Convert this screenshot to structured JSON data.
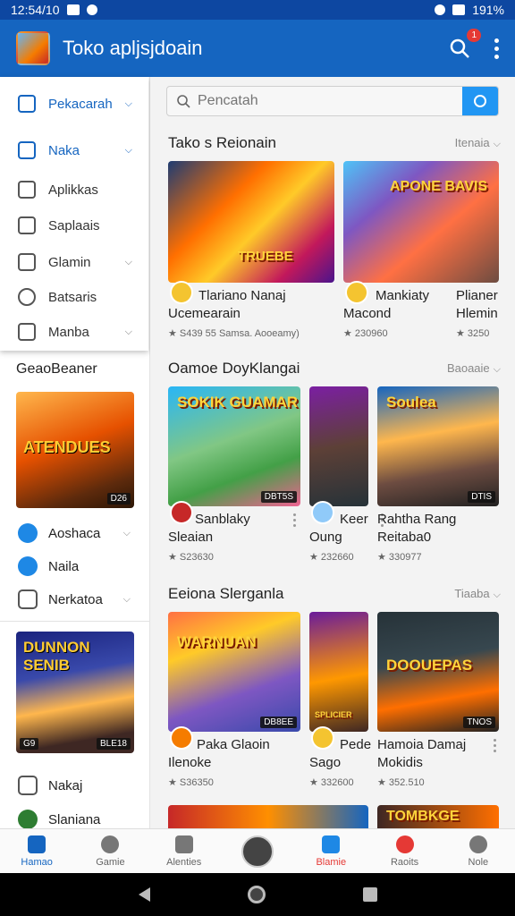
{
  "status_bar": {
    "time": "12:54/10",
    "battery": "191%"
  },
  "app_bar": {
    "title": "Toko apljsjdoain",
    "notification_count": "1"
  },
  "menu": {
    "items": [
      {
        "label": "Pekacarah",
        "icon": "home-icon",
        "active": true,
        "chevron": true
      },
      {
        "label": "Naka",
        "icon": "recycle-icon",
        "active": true,
        "chevron": true
      },
      {
        "label": "Aplikkas",
        "icon": "folder-icon",
        "active": false,
        "chevron": false
      },
      {
        "label": "Saplaais",
        "icon": "app-box-icon",
        "active": false,
        "chevron": false
      },
      {
        "label": "Glamin",
        "icon": "gamepad-icon",
        "active": false,
        "chevron": true
      },
      {
        "label": "Batsaris",
        "icon": "chat-icon",
        "active": false,
        "chevron": false
      },
      {
        "label": "Manba",
        "icon": "tag-icon",
        "active": false,
        "chevron": true
      }
    ]
  },
  "left_panel": {
    "section_title": "GeaoBeaner",
    "featured1": {
      "title": "ATENDUES",
      "tag": "D26"
    },
    "list1": [
      {
        "label": "Aoshaca",
        "icon": "compass-icon",
        "chevron": true
      },
      {
        "label": "Naila",
        "icon": "star-icon",
        "chevron": false
      },
      {
        "label": "Nerkatoa",
        "icon": "shield-icon",
        "chevron": true
      }
    ],
    "featured2": {
      "title": "DUNNON SENIB",
      "tag1": "G9",
      "tag2": "BLE18"
    },
    "list2": [
      {
        "label": "Nakaj",
        "icon": "bag-icon"
      },
      {
        "label": "Slaniana",
        "icon": "leaf-icon"
      }
    ]
  },
  "search": {
    "placeholder": "Pencatah",
    "value": ""
  },
  "sections": [
    {
      "title": "Tako s Reionain",
      "more": "Itenaia",
      "cards": [
        {
          "art_title": "TRUEBE",
          "name1": "Tlariano Nanaj",
          "name2": "Ucemearain",
          "meta": "★ S439 55 Samsa. Aooeamy)",
          "tag": ""
        },
        {
          "art_title": "APONE BAVIS",
          "name1": "Mankiaty",
          "name2": "Macond",
          "meta": "★ 230960",
          "tag": ""
        },
        {
          "art_title": "",
          "name1": "Plianer",
          "name2": "Hlemin",
          "meta": "★ 3250",
          "tag": ""
        }
      ]
    },
    {
      "title": "Oamoe DoyKlangai",
      "more": "Baoaaie",
      "cards": [
        {
          "art_title": "SOKIK GUAMAR",
          "name1": "Sanblaky",
          "name2": "Sleaian",
          "meta": "★ S23630",
          "tag": "DBT5S"
        },
        {
          "art_title": "",
          "name1": "Keer",
          "name2": "Oung",
          "meta": "★ 232660",
          "tag": ""
        },
        {
          "art_title": "Soulea",
          "name1": "Rahtha Rang",
          "name2": "Reitaba0",
          "meta": "★ 330977",
          "tag": "DTIS"
        }
      ]
    },
    {
      "title": "Eeiona Slerganla",
      "more": "Tiaaba",
      "cards": [
        {
          "art_title": "WARNUAN",
          "name1": "Paka Glaoin",
          "name2": "Ilenoke",
          "meta": "★ S36350",
          "tag": "DB8EE"
        },
        {
          "art_title": "SPLICIER",
          "name1": "Pede",
          "name2": "Sago",
          "meta": "★ 332600",
          "tag": ""
        },
        {
          "art_title": "DOOUEPAS",
          "name1": "Hamoia Damaj",
          "name2": "Mokidis",
          "meta": "★ 352.510",
          "tag": "TNOS"
        }
      ]
    },
    {
      "title": "",
      "more": "",
      "cards": [
        {
          "art_title": "",
          "name1": "",
          "name2": "",
          "meta": "",
          "tag": ""
        },
        {
          "art_title": "TOMBKGE",
          "name1": "",
          "name2": "",
          "meta": "",
          "tag": ""
        }
      ]
    }
  ],
  "bottom_nav": [
    {
      "label": "Hamao",
      "icon": "home-icon",
      "state": "active"
    },
    {
      "label": "Gamie",
      "icon": "person-icon",
      "state": ""
    },
    {
      "label": "Alenties",
      "icon": "triangle-icon",
      "state": ""
    },
    {
      "label": "",
      "icon": "fab-icon",
      "state": ""
    },
    {
      "label": "Blamie",
      "icon": "apps-icon",
      "state": "hot"
    },
    {
      "label": "Raoits",
      "icon": "compass-icon",
      "state": ""
    },
    {
      "label": "Nole",
      "icon": "profile-icon",
      "state": ""
    }
  ],
  "colors": {
    "primary": "#1565c0",
    "status": "#0d47a1",
    "accent": "#2196f3",
    "hot": "#e53935"
  }
}
